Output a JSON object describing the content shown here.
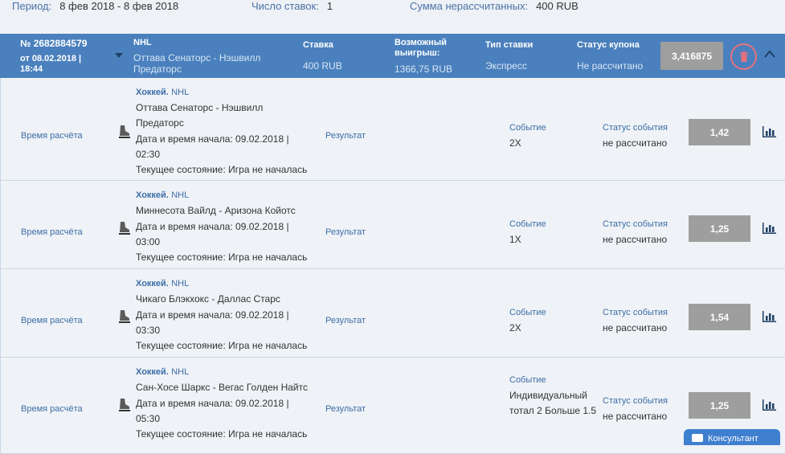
{
  "summary": {
    "period_label": "Период:",
    "period_value": "8 фев 2018 - 8 фев 2018",
    "bets_label": "Число ставок:",
    "bets_value": "1",
    "unsettled_label": "Сумма нерассчитанных:",
    "unsettled_value": "400 RUB"
  },
  "coupon": {
    "number": "№ 2682884579",
    "date_line1": "от 08.02.2018 |",
    "date_line2": "18:44",
    "league": "NHL",
    "match_line1": "Оттава Сенаторс - Нэшвилл",
    "match_line2": "Предаторс",
    "stake_label": "Ставка",
    "stake_value": "400 RUB",
    "win_label_line1": "Возможный",
    "win_label_line2": "выигрыш:",
    "win_value": "1366,75 RUB",
    "type_label": "Тип ставки",
    "type_value": "Экспресс",
    "status_label": "Статус купона",
    "status_value": "Не рассчитано",
    "total_coef": "3,416875"
  },
  "labels": {
    "settle_time": "Время расчёта",
    "result": "Результат",
    "event": "Событие",
    "event_status": "Статус события"
  },
  "events": [
    {
      "sport": "Хоккей.",
      "league": "NHL",
      "match_line1": "Оттава Сенаторс - Нэшвилл",
      "match_line2": "Предаторс",
      "start_line1": "Дата и время начала: 09.02.2018 |",
      "start_line2": "02:30",
      "state": "Текущее состояние: Игра не началась",
      "outcome": "2Х",
      "status": "не рассчитано",
      "coef": "1,42"
    },
    {
      "sport": "Хоккей.",
      "league": "NHL",
      "match_line1": "Миннесота Вайлд - Аризона Койотс",
      "match_line2": "",
      "start_line1": "Дата и время начала: 09.02.2018 |",
      "start_line2": "03:00",
      "state": "Текущее состояние: Игра не началась",
      "outcome": "1Х",
      "status": "не рассчитано",
      "coef": "1,25"
    },
    {
      "sport": "Хоккей.",
      "league": "NHL",
      "match_line1": "Чикаго Блэкхокс - Даллас Старс",
      "match_line2": "",
      "start_line1": "Дата и время начала: 09.02.2018 |",
      "start_line2": "03:30",
      "state": "Текущее состояние: Игра не началась",
      "outcome": "2Х",
      "status": "не рассчитано",
      "coef": "1,54"
    },
    {
      "sport": "Хоккей.",
      "league": "NHL",
      "match_line1": "Сан-Хосе Шаркс - Вегас Голден Найтс",
      "match_line2": "",
      "start_line1": "Дата и время начала: 09.02.2018 |",
      "start_line2": "05:30",
      "state": "Текущее состояние: Игра не началась",
      "outcome": "Индивидуальный тотал 2 Больше 1.5",
      "status": "не рассчитано",
      "coef": "1,25"
    }
  ],
  "consult_label": "Консультант",
  "colors": {
    "header": "#4a80bd",
    "coef": "#9e9e9e",
    "link": "#3c6ea8",
    "trash": "#e8717c"
  }
}
